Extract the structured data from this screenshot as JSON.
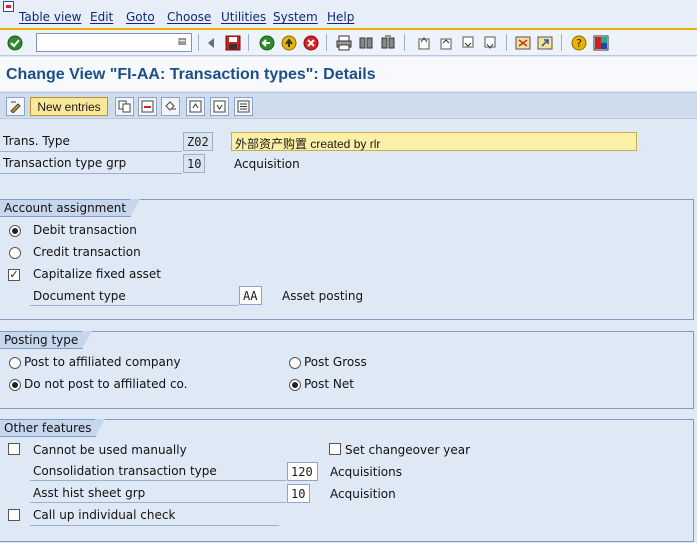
{
  "menu": [
    "Table view",
    "Edit",
    "Goto",
    "Choose",
    "Utilities",
    "System",
    "Help"
  ],
  "toolbar": {
    "command_value": "",
    "icons": [
      "enter-check-icon",
      "back-triangle-icon",
      "save-icon",
      "back-icon",
      "exit-icon",
      "cancel-icon",
      "print-icon",
      "find-icon",
      "find-next-icon",
      "first-page-icon",
      "prev-page-icon",
      "next-page-icon",
      "last-page-icon",
      "new-session-icon",
      "shortcut-icon",
      "help-icon",
      "customize-layout-icon"
    ]
  },
  "title": "Change View \"FI-AA: Transaction types\": Details",
  "app_toolbar": {
    "new_entries": "New entries"
  },
  "header_fields": {
    "trans_type_label": "Trans. Type",
    "trans_type_value": "Z02",
    "trans_type_desc": "外部资产购置 created by rlr",
    "group_label": "Transaction type grp",
    "group_value": "10",
    "group_desc": "Acquisition"
  },
  "account_assignment": {
    "title": "Account assignment",
    "debit": "Debit transaction",
    "credit": "Credit transaction",
    "capitalize": "Capitalize fixed asset",
    "doc_type_label": "Document type",
    "doc_type_value": "AA",
    "doc_type_desc": "Asset posting",
    "debit_selected": true,
    "capitalize_checked": true
  },
  "posting_type": {
    "title": "Posting type",
    "post_affiliated": "Post to affiliated company",
    "no_post_affiliated": "Do not post to affiliated co.",
    "post_gross": "Post Gross",
    "post_net": "Post Net"
  },
  "other_features": {
    "title": "Other features",
    "cannot_manual": "Cannot be used manually",
    "set_changeover": "Set changeover year",
    "consolidation_label": "Consolidation transaction type",
    "consolidation_value": "120",
    "consolidation_desc": "Acquisitions",
    "asset_hist_label": "Asst hist sheet grp",
    "asset_hist_value": "10",
    "asset_hist_desc": "Acquisition",
    "call_up_check": "Call up individual check"
  }
}
